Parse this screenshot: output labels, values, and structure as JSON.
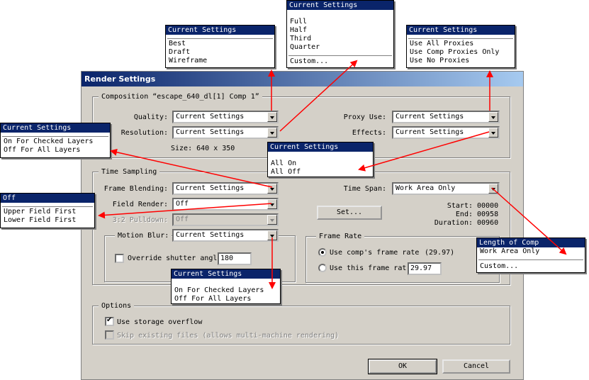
{
  "dialog": {
    "title": "Render Settings",
    "composition_label": "Composition “escape_640_dl[1] Comp 1”",
    "quality_label": "Quality:",
    "quality_value": "Current Settings",
    "resolution_label": "Resolution:",
    "resolution_value": "Current Settings",
    "size_text": "Size: 640 x 350",
    "proxy_use_label": "Proxy Use:",
    "proxy_use_value": "Current Settings",
    "effects_label": "Effects:",
    "effects_value": "Current Settings",
    "time_sampling_label": "Time Sampling",
    "frame_blending_label": "Frame Blending:",
    "frame_blending_value": "Current Settings",
    "field_render_label": "Field Render:",
    "field_render_value": "Off",
    "pulldown_label": "3:2 Pulldown:",
    "pulldown_value": "Off",
    "motion_blur_label": "Motion Blur:",
    "motion_blur_value": "Current Settings",
    "override_label": "Override shutter angl",
    "override_value": "180",
    "time_span_label": "Time Span:",
    "time_span_value": "Work Area Only",
    "set_button": "Set...",
    "start_label": "Start:",
    "start_value": "00000",
    "end_label": "End:",
    "end_value": "00958",
    "duration_label": "Duration:",
    "duration_value": "00960",
    "frame_rate_label": "Frame Rate",
    "use_comp_rate_label": "Use comp's frame rate",
    "comp_rate_value": "(29.97)",
    "use_this_rate_label": "Use this frame rat",
    "this_rate_value": "29.97",
    "options_label": "Options",
    "storage_overflow_label": "Use storage overflow",
    "skip_existing_label": "Skip existing files (allows multi-machine rendering)",
    "ok_button": "OK",
    "cancel_button": "Cancel"
  },
  "popups": {
    "quality": {
      "header": "Current Settings",
      "items": [
        "Best",
        "Draft",
        "Wireframe"
      ]
    },
    "resolution": {
      "header": "Current Settings",
      "items": [
        "Full",
        "Half",
        "Third",
        "Quarter"
      ],
      "extra": "Custom..."
    },
    "proxy": {
      "header": "Current Settings",
      "items": [
        "Use All Proxies",
        "Use Comp Proxies Only",
        "Use No Proxies"
      ]
    },
    "frame_blending": {
      "header": "Current Settings",
      "items": [
        "On For Checked Layers",
        "Off For All Layers"
      ]
    },
    "effects": {
      "header": "Current Settings",
      "items": [
        "All On",
        "All Off"
      ]
    },
    "field_render": {
      "header": "Off",
      "items": [
        "Upper Field First",
        "Lower Field First"
      ]
    },
    "time_span": {
      "header": "Length of Comp",
      "items": [
        "Work Area Only"
      ],
      "extra": "Custom..."
    },
    "motion_blur": {
      "header": "Current Settings",
      "items": [
        "On For Checked Layers",
        "Off For All Layers"
      ]
    }
  },
  "colors": {
    "arrow": "#ff0000",
    "selection": "#0a246a",
    "dialog_bg": "#d4d0c8"
  }
}
